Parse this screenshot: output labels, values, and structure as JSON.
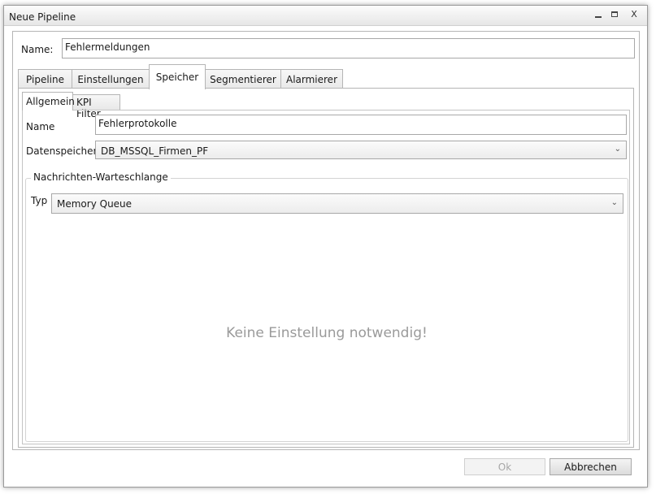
{
  "window": {
    "title": "Neue Pipeline",
    "close_glyph": "X"
  },
  "main": {
    "name_label": "Name:",
    "name_value": "Fehlermeldungen",
    "tabs": [
      {
        "label": "Pipeline"
      },
      {
        "label": "Einstellungen"
      },
      {
        "label": "Speicher",
        "active": true
      },
      {
        "label": "Segmentierer"
      },
      {
        "label": "Alarmierer"
      }
    ]
  },
  "speicher": {
    "subtabs": [
      {
        "label": "Allgemein",
        "active": true
      },
      {
        "label": "KPI Filter"
      }
    ],
    "name_label": "Name",
    "name_value": "Fehlerprotokolle",
    "datenspeicher_label": "Datenspeicher",
    "datenspeicher_value": "DB_MSSQL_Firmen_PF",
    "group_title": "Nachrichten-Warteschlange",
    "typ_label": "Typ",
    "typ_value": "Memory Queue",
    "empty_message": "Keine Einstellung notwendig!"
  },
  "footer": {
    "ok_label": "Ok",
    "cancel_label": "Abbrechen"
  },
  "colors": {
    "border": "#b5b5b5",
    "placeholder_text": "#9a9a9a",
    "disabled_text": "#a6a6a6"
  },
  "icons": {
    "minimize": "minimize-icon",
    "maximize": "maximize-icon",
    "close": "close-icon",
    "dropdown": "chevron-down-icon"
  }
}
